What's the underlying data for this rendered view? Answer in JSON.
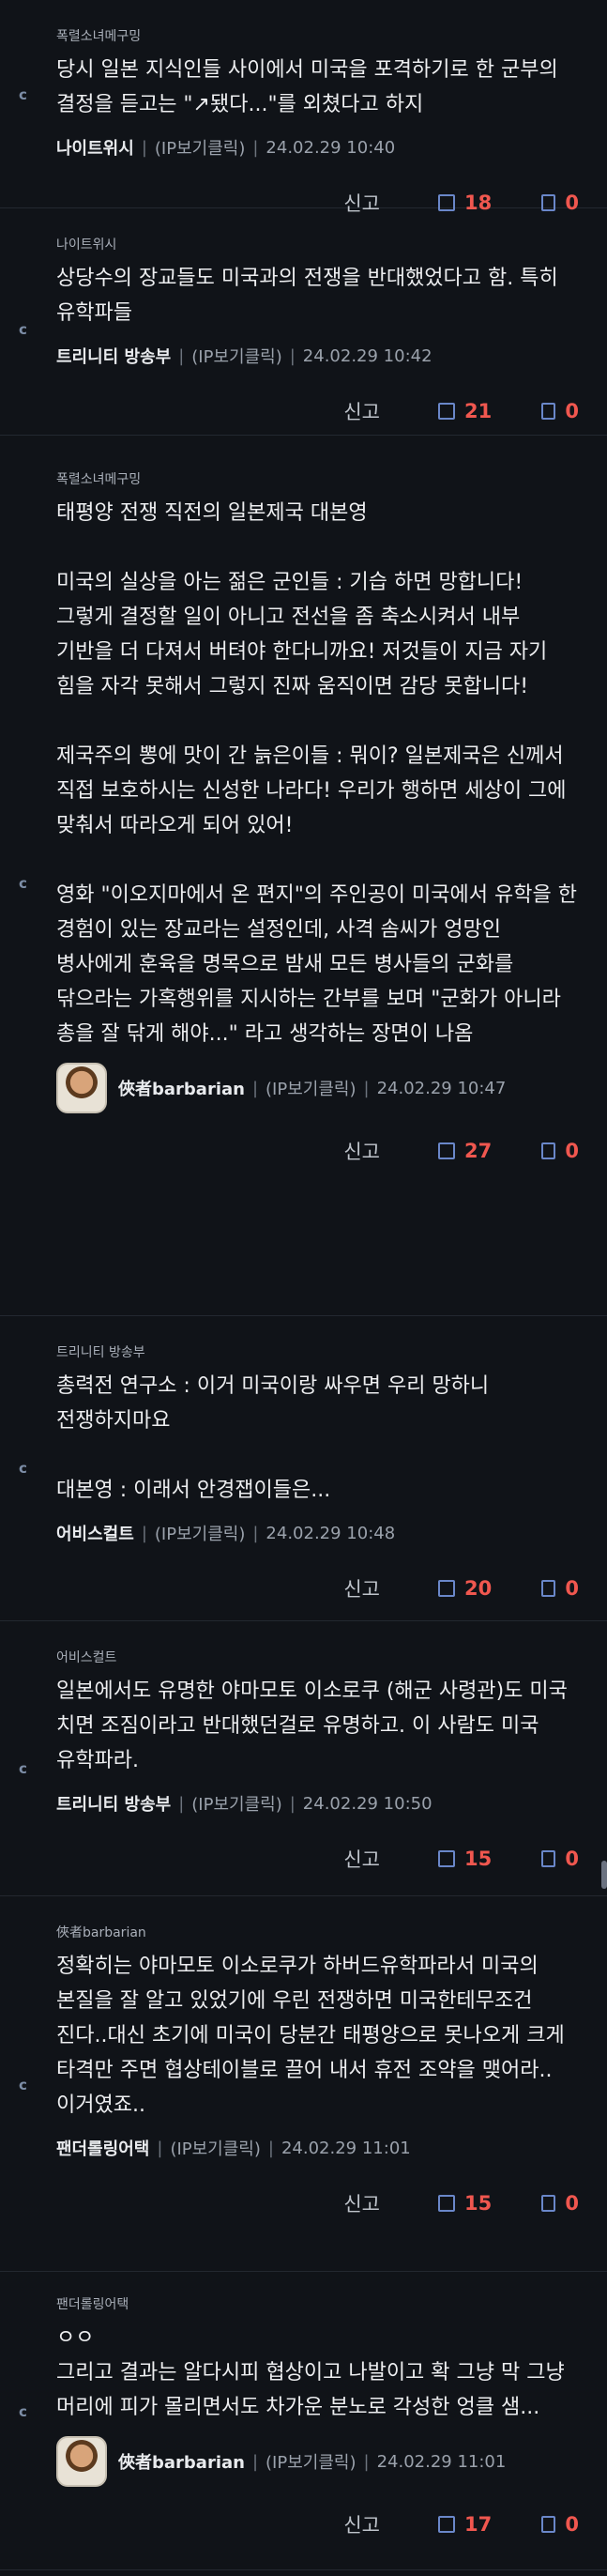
{
  "comments": [
    {
      "reply_to": "폭렬소녀메구밍",
      "lines": [
        "당시 일본 지식인들 사이에서 미국을 포격하기로 한 군부의 결정을 듣고는 \"↗됐다...\"를 외쳤다고 하지"
      ],
      "author": "나이트위시",
      "ip": "(IP보기클릭)",
      "time": "24.02.29 10:40",
      "has_avatar": false,
      "report": "신고",
      "up": "18",
      "down": "0"
    },
    {
      "reply_to": "나이트위시",
      "lines": [
        "상당수의 장교들도 미국과의 전쟁을 반대했었다고 함. 특히 유학파들"
      ],
      "author": "트리니티 방송부",
      "ip": "(IP보기클릭)",
      "time": "24.02.29 10:42",
      "has_avatar": false,
      "report": "신고",
      "up": "21",
      "down": "0"
    },
    {
      "reply_to": "폭렬소녀메구밍",
      "lines": [
        "태평양 전쟁 직전의 일본제국 대본영",
        "",
        "미국의 실상을 아는 젊은 군인들 : 기습 하면 망합니다! 그렇게 결정할 일이 아니고 전선을 좀 축소시켜서 내부 기반을 더 다져서 버텨야 한다니까요! 저것들이 지금 자기 힘을 자각 못해서 그렇지 진짜 움직이면 감당 못합니다!",
        "",
        "제국주의 뽕에 맛이 간 늙은이들 : 뭐이? 일본제국은 신께서 직접 보호하시는 신성한 나라다! 우리가 행하면 세상이 그에 맞춰서 따라오게 되어 있어!",
        "",
        "영화 \"이오지마에서 온 편지\"의 주인공이 미국에서 유학을 한 경험이 있는 장교라는 설정인데, 사격 솜씨가 엉망인 병사에게 훈육을 명목으로 밤새 모든 병사들의 군화를 닦으라는 가혹행위를 지시하는 간부를 보며 \"군화가 아니라 총을 잘 닦게 해야...\" 라고 생각하는 장면이 나옴"
      ],
      "author": "俠者barbarian",
      "ip": "(IP보기클릭)",
      "time": "24.02.29 10:47",
      "has_avatar": true,
      "report": "신고",
      "up": "27",
      "down": "0"
    },
    {
      "reply_to": "트리니티 방송부",
      "lines": [
        "총력전 연구소 : 이거 미국이랑 싸우면 우리 망하니 전쟁하지마요",
        "",
        "대본영 : 이래서 안경잽이들은..."
      ],
      "author": "어비스컬트",
      "ip": "(IP보기클릭)",
      "time": "24.02.29 10:48",
      "has_avatar": false,
      "report": "신고",
      "up": "20",
      "down": "0"
    },
    {
      "reply_to": "어비스컬트",
      "lines": [
        "일본에서도 유명한 야마모토 이소로쿠 (해군 사령관)도 미국 치면 조짐이라고 반대했던걸로 유명하고. 이 사람도 미국 유학파라."
      ],
      "author": "트리니티 방송부",
      "ip": "(IP보기클릭)",
      "time": "24.02.29 10:50",
      "has_avatar": false,
      "report": "신고",
      "up": "15",
      "down": "0"
    },
    {
      "reply_to": "俠者barbarian",
      "lines": [
        "정확히는 야마모토 이소로쿠가 하버드유학파라서 미국의 본질을 잘 알고 있었기에 우린 전쟁하면 미국한테무조건 진다..대신 초기에 미국이 당분간 태평양으로 못나오게 크게 타격만 주면 협상테이블로 끌어 내서 휴전 조약을 맺어라..이거였죠.."
      ],
      "author": "팬더롤링어택",
      "ip": "(IP보기클릭)",
      "time": "24.02.29 11:01",
      "has_avatar": false,
      "report": "신고",
      "up": "15",
      "down": "0"
    },
    {
      "reply_to": "팬더롤링어택",
      "lines": [
        "ㅇㅇ",
        "그리고 결과는 알다시피 협상이고 나발이고 확 그냥 막 그냥 머리에 피가 몰리면서도 차가운 분노로 각성한 엉클 샘..."
      ],
      "author": "俠者barbarian",
      "ip": "(IP보기클릭)",
      "time": "24.02.29 11:01",
      "has_avatar": true,
      "report": "신고",
      "up": "17",
      "down": "0"
    }
  ],
  "comment_icon": "comment-reply-icon"
}
